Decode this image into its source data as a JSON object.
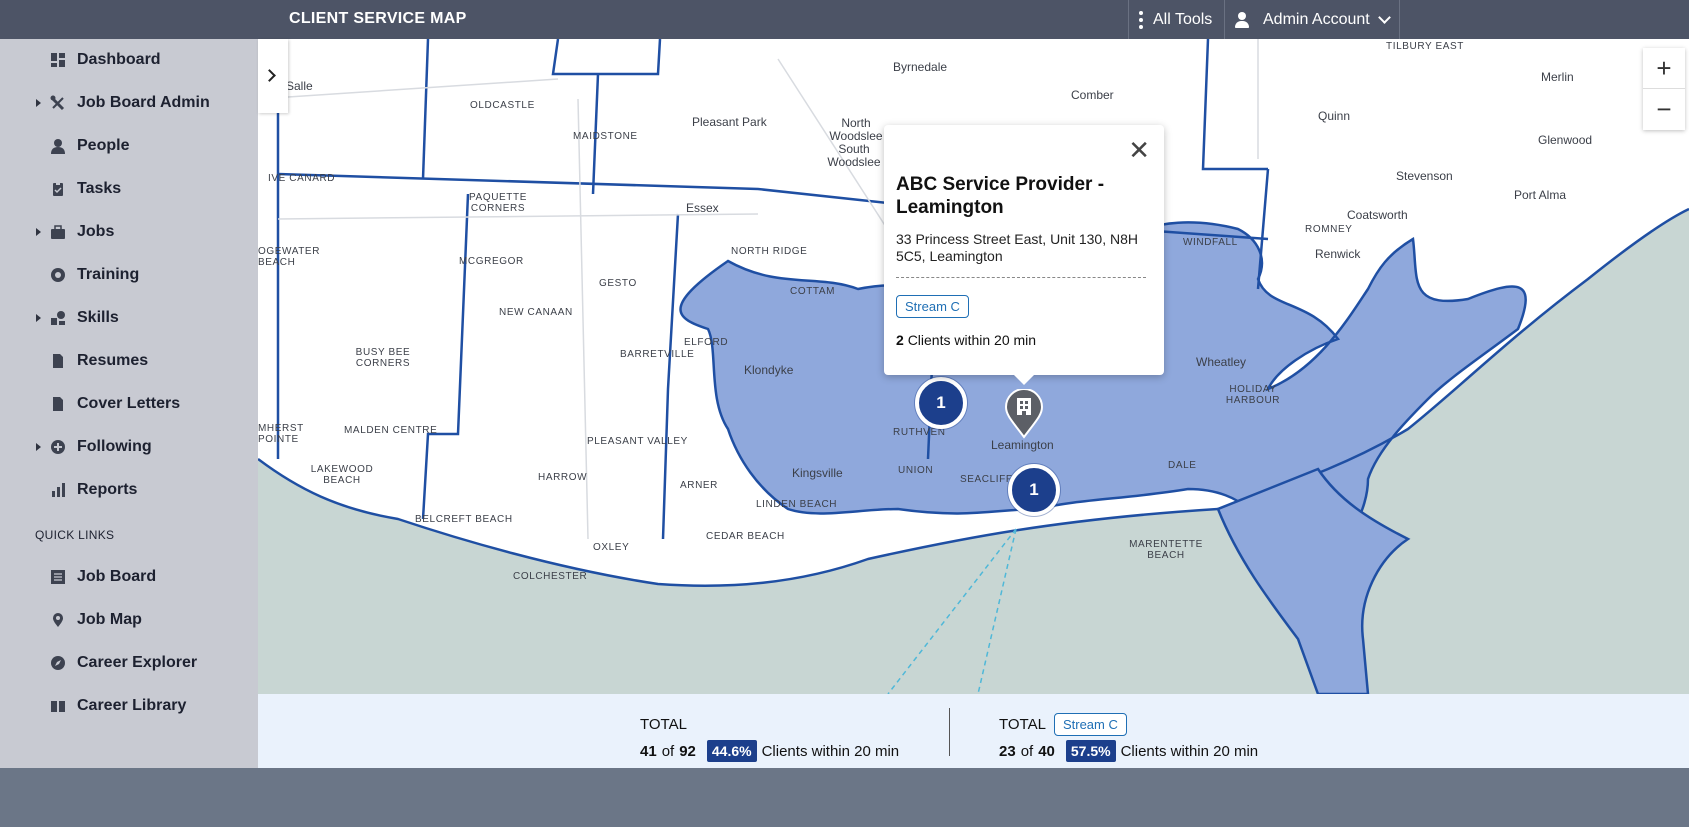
{
  "app": {
    "title": "CLIENT SERVICE MAP"
  },
  "topbar": {
    "all_tools": "All Tools",
    "account": "Admin Account"
  },
  "sidebar": {
    "items": [
      {
        "label": "Dashboard",
        "icon": "dashboard-icon",
        "expandable": false
      },
      {
        "label": "Job Board Admin",
        "icon": "tools-icon",
        "expandable": true
      },
      {
        "label": "People",
        "icon": "person-icon",
        "expandable": false
      },
      {
        "label": "Tasks",
        "icon": "clipboard-icon",
        "expandable": false
      },
      {
        "label": "Jobs",
        "icon": "briefcase-icon",
        "expandable": true
      },
      {
        "label": "Training",
        "icon": "training-icon",
        "expandable": false
      },
      {
        "label": "Skills",
        "icon": "skills-icon",
        "expandable": true
      },
      {
        "label": "Resumes",
        "icon": "document-icon",
        "expandable": false
      },
      {
        "label": "Cover Letters",
        "icon": "document-icon",
        "expandable": false
      },
      {
        "label": "Following",
        "icon": "plus-circle-icon",
        "expandable": true
      },
      {
        "label": "Reports",
        "icon": "bar-chart-icon",
        "expandable": false
      }
    ],
    "quick_links_title": "QUICK LINKS",
    "quick_links": [
      {
        "label": "Job Board",
        "icon": "list-icon"
      },
      {
        "label": "Job Map",
        "icon": "map-pin-icon"
      },
      {
        "label": "Career Explorer",
        "icon": "compass-icon"
      },
      {
        "label": "Career Library",
        "icon": "book-icon"
      }
    ]
  },
  "map": {
    "labels": [
      "Byrnedale",
      "Comber",
      "TILBURY EAST",
      "Merlin",
      "Quinn",
      "Glenwood",
      "Stevenson",
      "Port Alma",
      "Coatsworth",
      "ROMNEY",
      "Renwick",
      "Salle",
      "OLDCASTLE",
      "MAIDSTONE",
      "Pleasant Park",
      "North Woodslee",
      "South Woodslee",
      "Essex",
      "PAQUETTE CORNERS",
      "IVE CANARD",
      "OGEWATER BEACH",
      "MCGREGOR",
      "GESTO",
      "NORTH RIDGE",
      "COTTAM",
      "NEW CANAAN",
      "BARRETVILLE",
      "ELFORD",
      "Klondyke",
      "BUSY BEE CORNERS",
      "PLEASANT VALLEY",
      "RUTHVEN",
      "Leamington",
      "Wheatley",
      "HOLIDAY HARBOUR",
      "MALDEN CENTRE",
      "MHERST POINTE",
      "LAKEWOOD BEACH",
      "HARROW",
      "ARNER",
      "Kingsville",
      "UNION",
      "LINDEN BEACH",
      "CEDAR BEACH",
      "BELCREFT BEACH",
      "OXLEY",
      "COLCHESTER",
      "MARENTETTE BEACH",
      "WINDFALL",
      "SEACLIFF",
      "DALE"
    ],
    "clusters": [
      "1",
      "1"
    ],
    "popup": {
      "title": "ABC Service Provider - Leamington",
      "address": "33 Princess Street East, Unit 130, N8H 5C5, Leamington",
      "badge": "Stream C",
      "count": "2",
      "count_text": "Clients within 20 min"
    },
    "colors": {
      "catchment": "#8fa8dc",
      "boundary": "#1f4fa3",
      "water": "#c8d6d3",
      "cluster": "#1c3f8c"
    }
  },
  "stats": {
    "left": {
      "head": "TOTAL",
      "count": "41",
      "of": "of",
      "total": "92",
      "pct": "44.6%",
      "text": "Clients within 20 min"
    },
    "right": {
      "head": "TOTAL",
      "badge": "Stream C",
      "count": "23",
      "of": "of",
      "total": "40",
      "pct": "57.5%",
      "text": "Clients within 20 min"
    }
  }
}
